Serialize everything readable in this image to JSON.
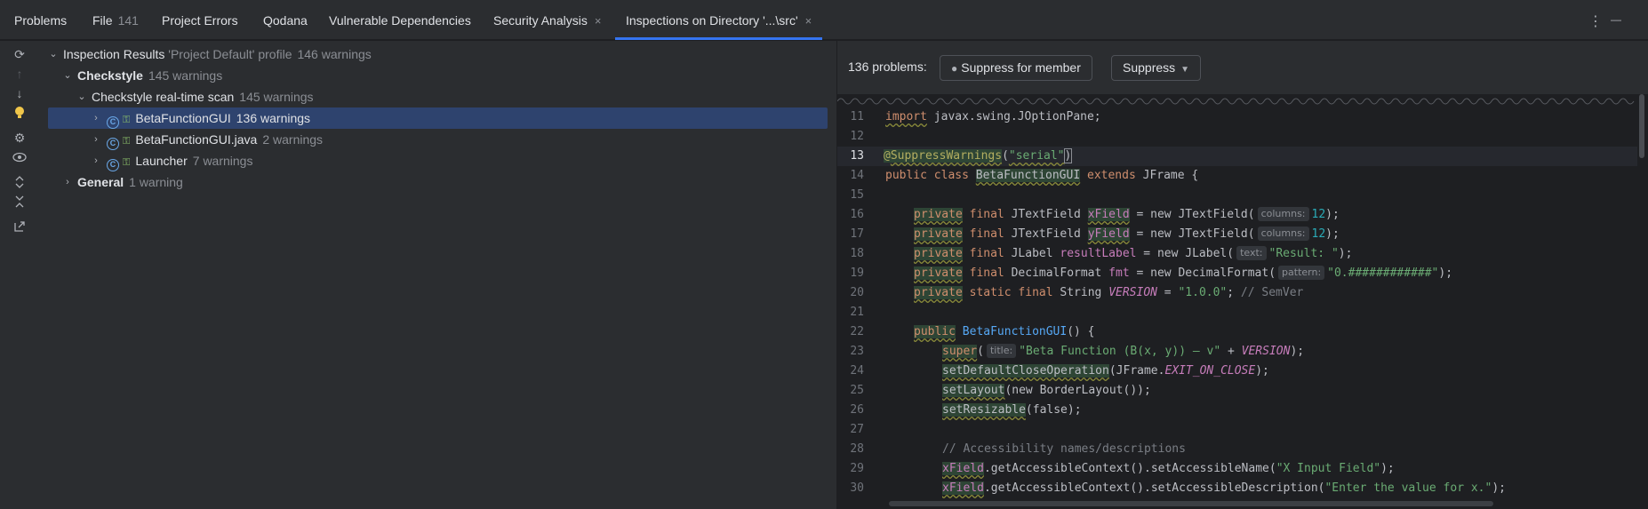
{
  "tabs": [
    {
      "label": "Problems"
    },
    {
      "label": "File",
      "count": "141"
    },
    {
      "label": "Project Errors"
    },
    {
      "label": "Qodana"
    },
    {
      "label": "Vulnerable Dependencies"
    },
    {
      "label": "Security Analysis",
      "close": "×"
    },
    {
      "label": "Inspections on Directory '...\\src'",
      "close": "×"
    }
  ],
  "toolbar_icons": {
    "more": "⋮",
    "minimize": "—"
  },
  "gutter_icons": [
    "rerun-icon",
    "prev-icon",
    "next-icon",
    "bulb-icon",
    "settings-icon",
    "eye-icon",
    "expand-icon",
    "collapse-icon",
    "export-icon"
  ],
  "tree": {
    "root": {
      "label": "Inspection Results",
      "profile": "'Project Default' profile",
      "count": "146 warnings"
    },
    "checkstyle": {
      "label": "Checkstyle",
      "count": "145 warnings"
    },
    "scan": {
      "label": "Checkstyle real-time scan",
      "count": "145 warnings"
    },
    "items": [
      {
        "label": "BetaFunctionGUI",
        "count": "136 warnings",
        "icon": "C"
      },
      {
        "label": "BetaFunctionGUI.java",
        "count": "2 warnings",
        "icon": "C"
      },
      {
        "label": "Launcher",
        "count": "7 warnings",
        "icon": "C"
      }
    ],
    "general": {
      "label": "General",
      "count": "1 warning"
    }
  },
  "detail": {
    "problems": "136 problems:",
    "suppress_member": "Suppress for member",
    "suppress": "Suppress"
  },
  "editor": {
    "line_numbers": [
      "11",
      "12",
      "13",
      "14",
      "15",
      "16",
      "17",
      "18",
      "19",
      "20",
      "21",
      "22",
      "23",
      "24",
      "25",
      "26",
      "27",
      "28",
      "29",
      "30"
    ],
    "current_line": "13",
    "fragments": {
      "import": "import",
      "l11_rest": " javax.swing.JOptionPane;",
      "at": "@",
      "suppress_ann": "SuppressWarnings",
      "lp": "(",
      "serial": "\"serial\"",
      "rp": ")",
      "public": "public",
      "class": "class",
      "cls_name": "BetaFunctionGUI",
      "extends": "extends",
      "jframe_brace": " JFrame {",
      "private": "private",
      "final": "final",
      "static": "static",
      "jtextfield": "JTextField",
      "jlabel": "JLabel",
      "decimalformat": "DecimalFormat",
      "string": "String",
      "xfield": "xField",
      "yfield": "yField",
      "resultlabel": "resultLabel",
      "fmt": "fmt",
      "version": "VERSION",
      "eq_new": " = new ",
      "columns_hint": "columns:",
      "text_hint": "text:",
      "pattern_hint": "pattern:",
      "title_hint": "title:",
      "twelve": "12",
      "close_semi": ");",
      "result_str": "\"Result: \"",
      "pattern_str": "\"0.############\"",
      "version_str": "\"1.0.0\"",
      "semver_cmt": "// SemVer",
      "ctor_tail": "() {",
      "super": "super",
      "title_str": "\"Beta Function (B(x, y)) — v\"",
      "plus": " + ",
      "set_close": "setDefaultCloseOperation",
      "jframe_dot": "JFrame.",
      "exit_on_close": "EXIT_ON_CLOSE",
      "set_layout": "setLayout",
      "new_border": "(new BorderLayout());",
      "set_resizable": "setResizable",
      "false_arg": "(false);",
      "a11y_cmt": "// Accessibility names/descriptions",
      "get_ctx": ".getAccessibleContext().",
      "set_name": "setAccessibleName(",
      "x_input_str": "\"X Input Field\"",
      "set_desc": "setAccessibleDescription(",
      "enter_x_str": "\"Enter the value for x.\""
    }
  }
}
